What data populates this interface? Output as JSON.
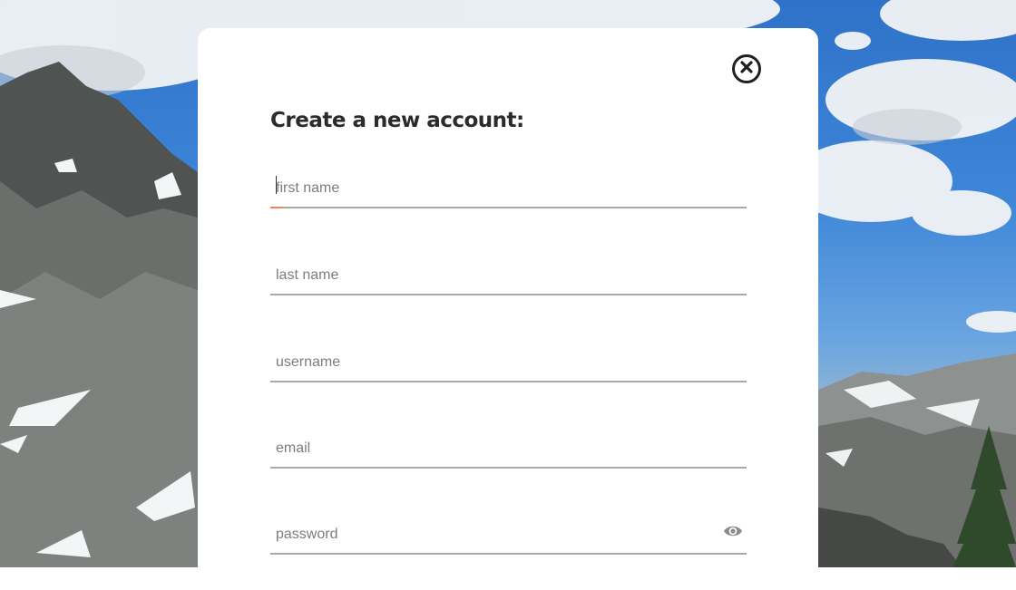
{
  "modal": {
    "title": "Create a new account:",
    "close_icon": "close-circle-icon"
  },
  "form": {
    "first_name": {
      "placeholder": "first name",
      "value": ""
    },
    "last_name": {
      "placeholder": "last name",
      "value": ""
    },
    "username": {
      "placeholder": "username",
      "value": ""
    },
    "email": {
      "placeholder": "email",
      "value": ""
    },
    "password": {
      "placeholder": "password",
      "value": "",
      "toggle_icon": "eye-icon"
    }
  },
  "colors": {
    "focus_accent": "#e8875a",
    "underline": "#a9a9a9",
    "title": "#2b2b2b"
  }
}
